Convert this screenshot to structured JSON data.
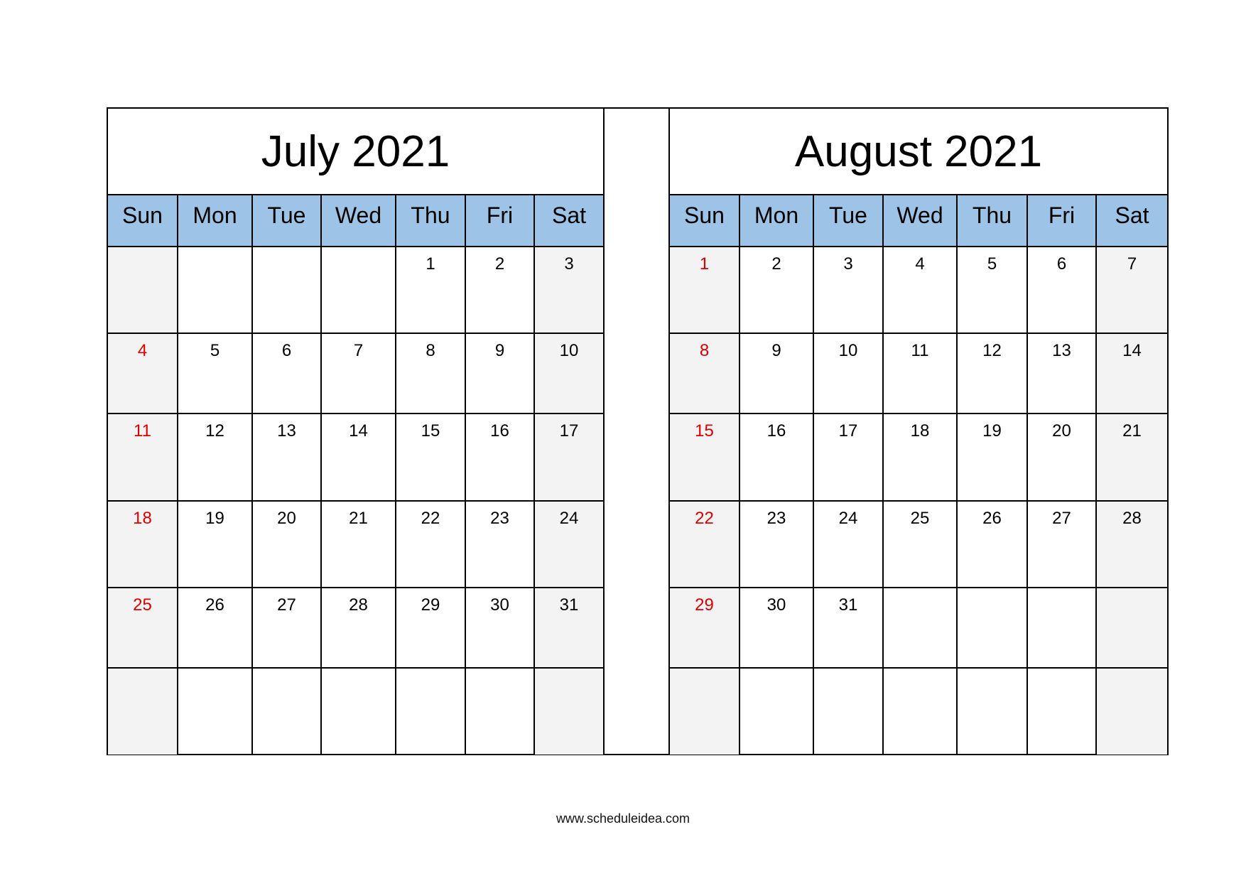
{
  "weekday_labels": [
    "Sun",
    "Mon",
    "Tue",
    "Wed",
    "Thu",
    "Fri",
    "Sat"
  ],
  "sunday_color": "#e00000",
  "header_color": "#9dc3e6",
  "weekend_shade": "#f3f3f3",
  "months": [
    {
      "title": "July 2021",
      "weeks": [
        [
          "",
          "",
          "",
          "",
          "1",
          "2",
          "3"
        ],
        [
          "4",
          "5",
          "6",
          "7",
          "8",
          "9",
          "10"
        ],
        [
          "11",
          "12",
          "13",
          "14",
          "15",
          "16",
          "17"
        ],
        [
          "18",
          "19",
          "20",
          "21",
          "22",
          "23",
          "24"
        ],
        [
          "25",
          "26",
          "27",
          "28",
          "29",
          "30",
          "31"
        ],
        [
          "",
          "",
          "",
          "",
          "",
          "",
          ""
        ]
      ]
    },
    {
      "title": "August 2021",
      "weeks": [
        [
          "1",
          "2",
          "3",
          "4",
          "5",
          "6",
          "7"
        ],
        [
          "8",
          "9",
          "10",
          "11",
          "12",
          "13",
          "14"
        ],
        [
          "15",
          "16",
          "17",
          "18",
          "19",
          "20",
          "21"
        ],
        [
          "22",
          "23",
          "24",
          "25",
          "26",
          "27",
          "28"
        ],
        [
          "29",
          "30",
          "31",
          "",
          "",
          "",
          ""
        ],
        [
          "",
          "",
          "",
          "",
          "",
          "",
          ""
        ]
      ]
    }
  ],
  "footer": "www.scheduleidea.com"
}
